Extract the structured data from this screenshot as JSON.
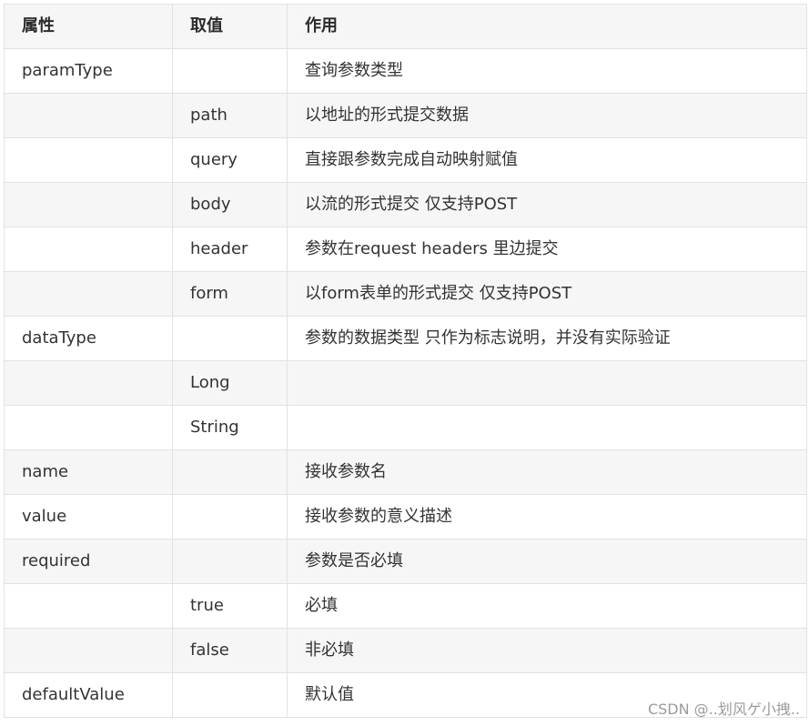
{
  "table": {
    "headers": [
      "属性",
      "取值",
      "作用"
    ],
    "rows": [
      [
        "paramType",
        "",
        "查询参数类型"
      ],
      [
        "",
        "path",
        "以地址的形式提交数据"
      ],
      [
        "",
        "query",
        "直接跟参数完成自动映射赋值"
      ],
      [
        "",
        "body",
        "以流的形式提交 仅支持POST"
      ],
      [
        "",
        "header",
        "参数在request headers 里边提交"
      ],
      [
        "",
        "form",
        "以form表单的形式提交 仅支持POST"
      ],
      [
        "dataType",
        "",
        "参数的数据类型 只作为标志说明，并没有实际验证"
      ],
      [
        "",
        "Long",
        ""
      ],
      [
        "",
        "String",
        ""
      ],
      [
        "name",
        "",
        "接收参数名"
      ],
      [
        "value",
        "",
        "接收参数的意义描述"
      ],
      [
        "required",
        "",
        "参数是否必填"
      ],
      [
        "",
        "true",
        "必填"
      ],
      [
        "",
        "false",
        "非必填"
      ],
      [
        "defaultValue",
        "",
        "默认值"
      ]
    ]
  },
  "watermark": "CSDN @..划风ゲ小拽.."
}
